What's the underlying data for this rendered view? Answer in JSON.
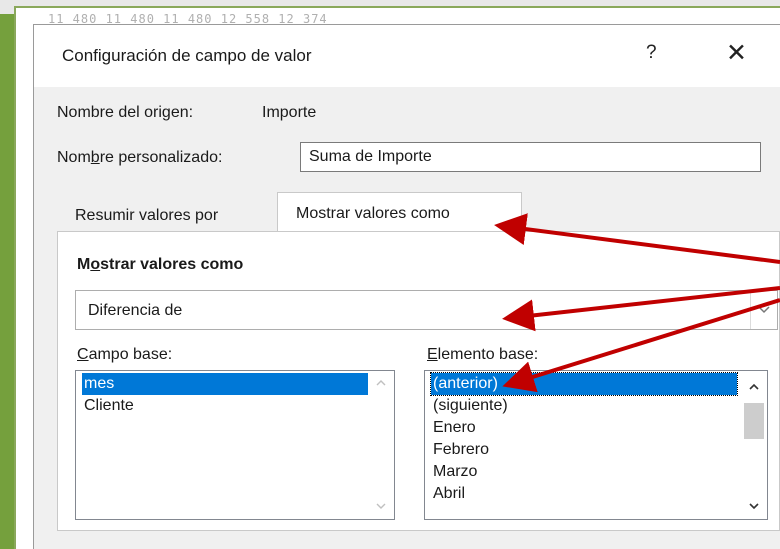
{
  "background_row": "11 480   11 480   11 480   12 558   12 374",
  "dialog": {
    "title": "Configuración de campo de valor",
    "help_label": "?",
    "close_label": "✕",
    "source_label": "Nombre del origen:",
    "source_value": "Importe",
    "custom_name_label_pre": "Nom",
    "custom_name_label_ul": "b",
    "custom_name_label_post": "re personalizado:",
    "custom_name_value": "Suma de Importe",
    "tabs": [
      {
        "label": "Resumir valores por",
        "active": false
      },
      {
        "label": "Mostrar valores como",
        "active": true
      }
    ],
    "group_title_pre": "M",
    "group_title_ul": "o",
    "group_title_post": "strar valores como",
    "show_as_value": "Diferencia de",
    "base_field_label_ul": "C",
    "base_field_label_post": "ampo base:",
    "base_field_items": [
      "mes",
      "Cliente"
    ],
    "base_item_label_ul": "E",
    "base_item_label_post": "lemento base:",
    "base_item_items": [
      "(anterior)",
      "(siguiente)",
      "Enero",
      "Febrero",
      "Marzo",
      "Abril"
    ]
  },
  "annotation_color": "#c00000"
}
